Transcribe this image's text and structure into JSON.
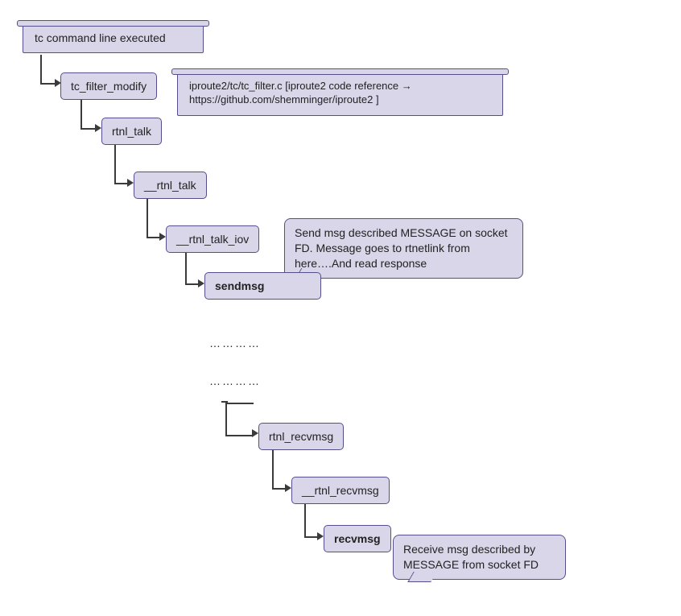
{
  "nodes": {
    "root": "tc command line executed",
    "n1": "tc_filter_modify",
    "n2": "rtnl_talk",
    "n3": "__rtnl_talk",
    "n4": "__rtnl_talk_iov",
    "n5": "sendmsg",
    "n6": "rtnl_recvmsg",
    "n7": "__rtnl_recvmsg",
    "n8": "recvmsg"
  },
  "annotations": {
    "codeRef": "iproute2/tc/tc_filter.c    [iproute2 code reference → https://github.com/shemminger/iproute2 ]",
    "sendNote": "Send msg described MESSAGE on socket FD. Message goes to rtnetlink from here….And read response",
    "recvNote": "Receive msg described by MESSAGE from socket FD"
  },
  "ellipsis": "…………"
}
